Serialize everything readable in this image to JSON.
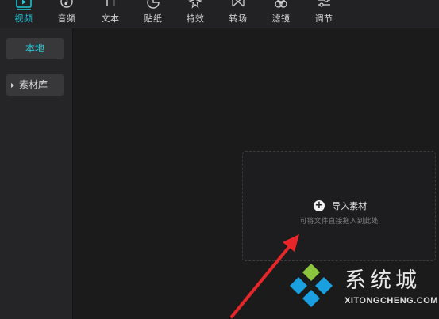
{
  "toolbar": {
    "tabs": [
      {
        "label": "视频",
        "icon": "video-play-icon",
        "active": true
      },
      {
        "label": "音频",
        "icon": "music-note-icon",
        "active": false
      },
      {
        "label": "文本",
        "icon": "text-icon",
        "active": false
      },
      {
        "label": "贴纸",
        "icon": "sticker-icon",
        "active": false
      },
      {
        "label": "特效",
        "icon": "sparkle-effect-icon",
        "active": false
      },
      {
        "label": "转场",
        "icon": "transition-icon",
        "active": false
      },
      {
        "label": "滤镜",
        "icon": "filter-circles-icon",
        "active": false
      },
      {
        "label": "调节",
        "icon": "sliders-adjust-icon",
        "active": false
      }
    ]
  },
  "sidebar": {
    "items": [
      {
        "label": "本地",
        "active": true
      },
      {
        "label": "素材库",
        "active": false
      }
    ]
  },
  "dropzone": {
    "import_label": "导入素材",
    "hint": "可将文件直接拖入到此处"
  },
  "watermark": {
    "title": "系统城",
    "url": "XITONGCHENG.COM"
  },
  "colors": {
    "accent": "#1fc9d8",
    "background": "#1b1b1c",
    "panel": "#252527",
    "arrow": "#e8262a",
    "logo_blue": "#1a9fe0",
    "logo_green": "#8cc63f"
  }
}
